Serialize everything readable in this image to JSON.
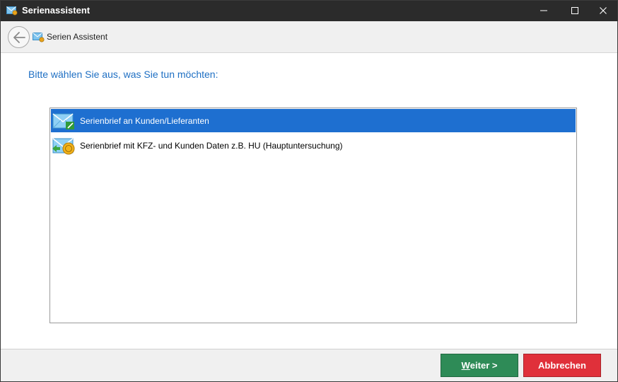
{
  "window": {
    "title": "Serienassistent",
    "controls": {
      "minimize": "minimize-icon",
      "maximize": "maximize-icon",
      "close": "close-icon"
    }
  },
  "header": {
    "title": "Serien Assistent",
    "back_icon": "back-arrow-icon",
    "wizard_icon": "envelope-icon"
  },
  "main": {
    "prompt": "Bitte wählen Sie aus, was Sie tun möchten:",
    "options": [
      {
        "label": "Serienbrief an Kunden/Lieferanten",
        "icon": "envelope-edit-icon",
        "selected": true
      },
      {
        "label": "Serienbrief mit KFZ- und Kunden Daten z.B. HU (Hauptuntersuchung)",
        "icon": "envelope-seal-icon",
        "selected": false
      }
    ]
  },
  "footer": {
    "next_accel": "W",
    "next_rest": "eiter >",
    "cancel_label": "Abbrechen"
  },
  "colors": {
    "titlebar": "#2b2b2b",
    "accent_text": "#1e6fc3",
    "selection": "#1e6fd0",
    "next_button": "#2e8b57",
    "cancel_button": "#e0303a"
  }
}
